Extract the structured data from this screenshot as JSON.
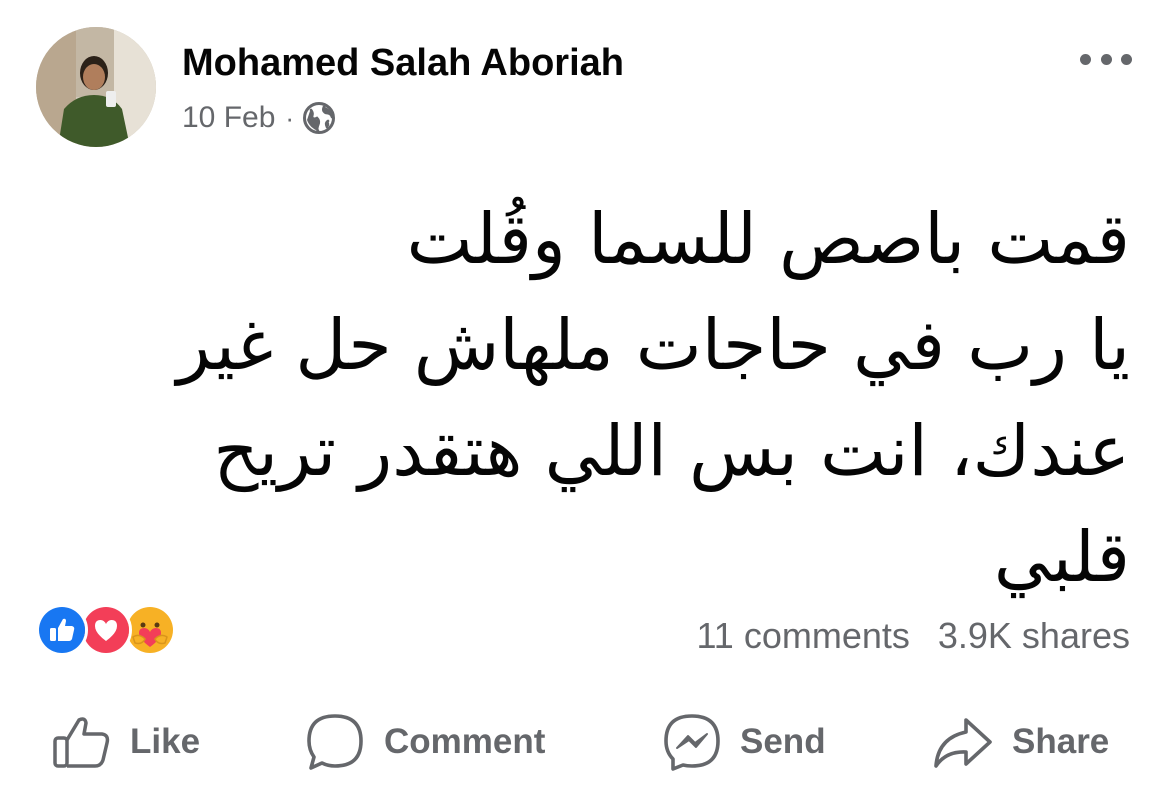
{
  "post": {
    "author": "Mohamed Salah Aboriah",
    "date": "10 Feb",
    "separator": "·",
    "audience_icon": "globe-icon",
    "text": "قمت باصص للسما وقُلت\nيا رب في حاجات ملهاش حل غير\nعندك، انت بس اللي هتقدر تريح\nقلبي"
  },
  "reactions": {
    "icons": [
      "like-reaction-icon",
      "love-reaction-icon",
      "care-reaction-icon"
    ],
    "colors": {
      "like": "#1877f2",
      "love": "#f33e58",
      "care": "#f7b125"
    }
  },
  "stats": {
    "comments": "11 comments",
    "shares": "3.9K shares"
  },
  "actions": {
    "like": "Like",
    "comment": "Comment",
    "send": "Send",
    "share": "Share"
  },
  "colors": {
    "text_primary": "#050505",
    "text_secondary": "#65676b",
    "background": "#ffffff"
  }
}
